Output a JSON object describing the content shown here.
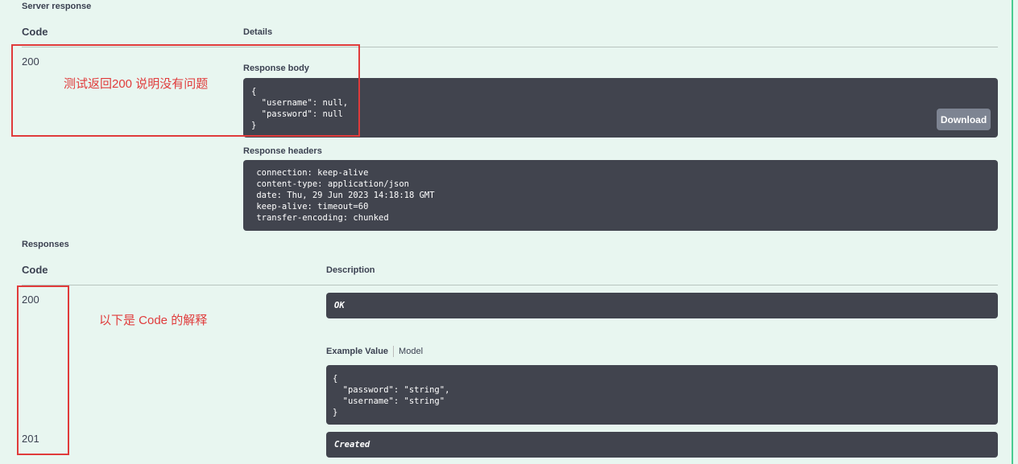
{
  "server_response": {
    "title": "Server response",
    "code_header": "Code",
    "details_header": "Details",
    "code": "200",
    "response_body_label": "Response body",
    "response_body": "{\n  \"username\": null,\n  \"password\": null\n}",
    "download_label": "Download",
    "response_headers_label": "Response headers",
    "response_headers": " connection: keep-alive\n content-type: application/json\n date: Thu, 29 Jun 2023 14:18:18 GMT\n keep-alive: timeout=60\n transfer-encoding: chunked"
  },
  "responses": {
    "title": "Responses",
    "code_header": "Code",
    "description_header": "Description",
    "items": [
      {
        "code": "200",
        "description": "OK",
        "example_tab": "Example Value",
        "model_tab": "Model",
        "example": "{\n  \"password\": \"string\",\n  \"username\": \"string\"\n}"
      },
      {
        "code": "201",
        "description": "Created"
      }
    ]
  },
  "annotations": {
    "note1": "测试返回200   说明没有问题",
    "note2": "以下是 Code 的解释",
    "color": "#e03b3b"
  },
  "colors": {
    "background": "#e8f6f0",
    "accent": "#49cc90",
    "code_block": "#41444e",
    "download_button": "#7d8492"
  }
}
